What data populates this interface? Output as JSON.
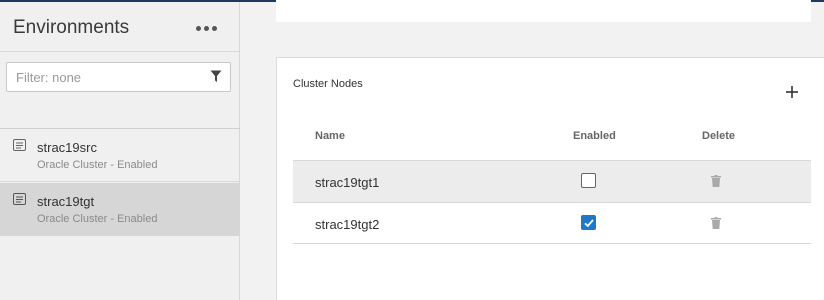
{
  "sidebar": {
    "title": "Environments",
    "filter_placeholder": "Filter: none",
    "items": [
      {
        "name": "strac19src",
        "subtitle": "Oracle Cluster - Enabled",
        "selected": false
      },
      {
        "name": "strac19tgt",
        "subtitle": "Oracle Cluster - Enabled",
        "selected": true
      }
    ]
  },
  "main": {
    "card_title": "Cluster Nodes",
    "columns": {
      "name": "Name",
      "enabled": "Enabled",
      "delete": "Delete"
    },
    "rows": [
      {
        "name": "strac19tgt1",
        "enabled": false
      },
      {
        "name": "strac19tgt2",
        "enabled": true
      }
    ]
  },
  "colors": {
    "accent": "#1f78c8",
    "topbar": "#1d3a5c",
    "selected_row": "#d6d6d6"
  },
  "icons": [
    "more-icon",
    "filter-icon",
    "environment-icon",
    "add-icon",
    "checkbox-icon",
    "trash-icon"
  ]
}
